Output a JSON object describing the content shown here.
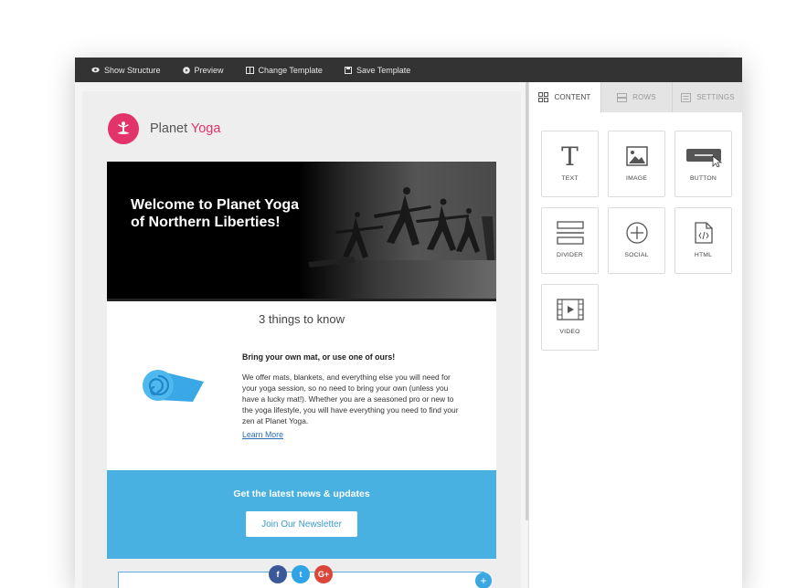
{
  "toolbar": {
    "show_structure": "Show Structure",
    "preview": "Preview",
    "change_template": "Change Template",
    "save_template": "Save Template"
  },
  "email": {
    "brand_name_first": "Planet",
    "brand_name_second": "Yoga",
    "hero_title": "Welcome to Planet Yoga of Northern Liberties!",
    "section_title": "3 things to know",
    "item_heading": "Bring your own mat, or use one of ours!",
    "item_body": "We offer mats, blankets, and everything else you will need for your yoga session, so no need to bring your own (unless you have a lucky mat!). Whether you are a seasoned pro or new to the yoga lifestyle, you will have everything you need to find your zen at Planet Yoga.",
    "item_link": "Learn More",
    "news_title": "Get the latest news & updates",
    "news_button": "Join Our Newsletter",
    "social": [
      "f",
      "t",
      "G+"
    ],
    "add_symbol": "+"
  },
  "sidebar": {
    "tabs": [
      "CONTENT",
      "ROWS",
      "SETTINGS"
    ],
    "active_tab": "CONTENT",
    "tiles": [
      "TEXT",
      "IMAGE",
      "BUTTON",
      "DIVIDER",
      "SOCIAL",
      "HTML",
      "VIDEO"
    ],
    "text_tile_glyph": "T"
  },
  "colors": {
    "brand": "#e2336a",
    "newsletter_bg": "#49b0e2",
    "toolbar_bg": "#333333"
  }
}
